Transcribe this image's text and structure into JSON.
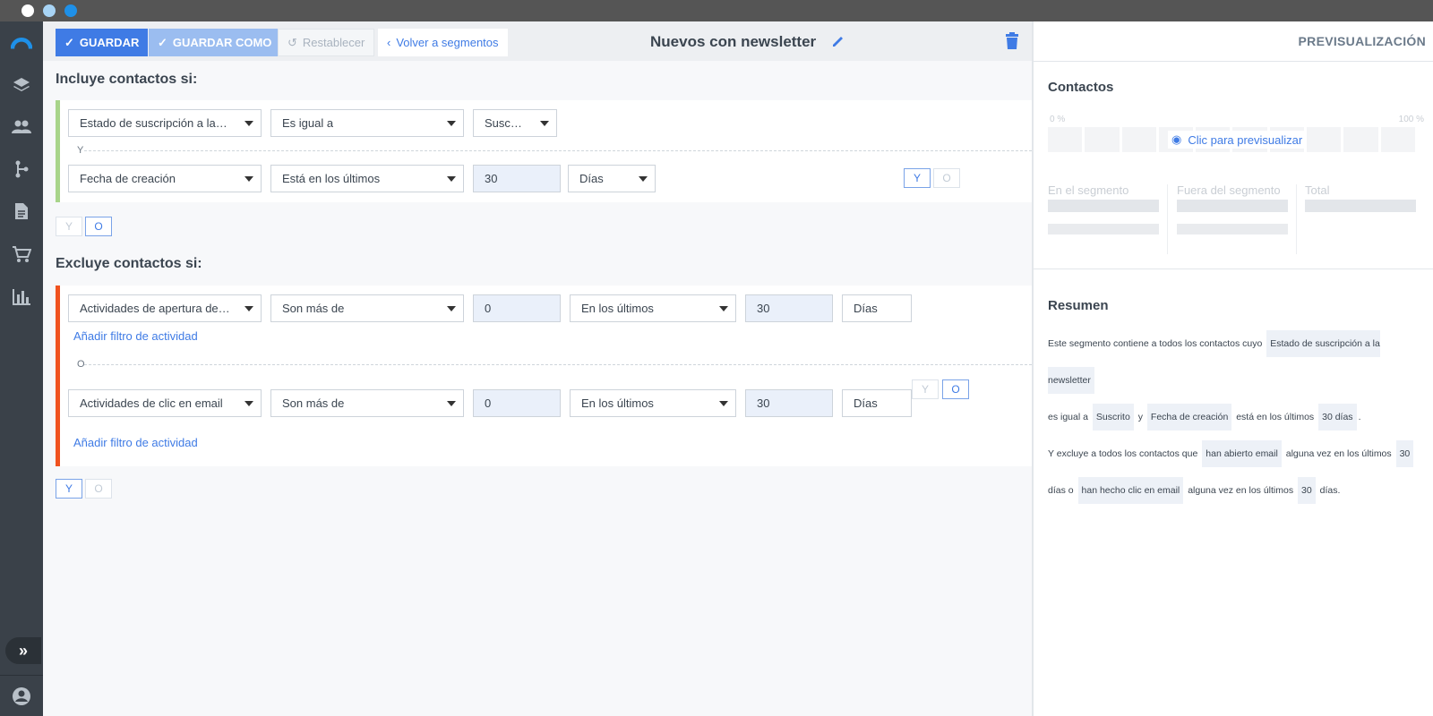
{
  "colors": {
    "accent": "#3f7be5",
    "include_bar": "#a8d48a",
    "exclude_bar": "#f0521f",
    "sidebar": "#3a4149"
  },
  "window": {
    "dots": [
      "#ffffff",
      "#a8d4f5",
      "#1e90e8"
    ]
  },
  "sidebar": {
    "items": [
      "logo-icon",
      "layers-icon",
      "contacts-icon",
      "automation-icon",
      "document-icon",
      "cart-icon",
      "chart-icon"
    ],
    "expand_icon": "double-chevron-icon",
    "user_icon": "user-icon"
  },
  "toolbar": {
    "save": "GUARDAR",
    "save_as": "GUARDAR COMO",
    "reset": "Restablecer",
    "back": "Volver a segmentos",
    "title": "Nuevos con newsletter",
    "edit_icon": "pencil-icon",
    "delete_icon": "trash-icon"
  },
  "include": {
    "heading": "Incluye contactos si:",
    "row1": {
      "field": "Estado de suscripción a la ne…",
      "op": "Es igual a",
      "value": "Suscrito"
    },
    "sep": "Y",
    "row2": {
      "field": "Fecha de creación",
      "op": "Está en los últimos",
      "value": "30",
      "unit": "Días"
    },
    "inner_toggle": {
      "y": "Y",
      "o": "O"
    },
    "outer_toggle": {
      "y": "Y",
      "o": "O"
    }
  },
  "exclude": {
    "heading": "Excluye contactos si:",
    "row1": {
      "field": "Actividades de apertura de e…",
      "op": "Son más de",
      "count": "0",
      "period": "En los últimos",
      "value": "30",
      "unit": "Días"
    },
    "add_filter": "Añadir filtro de actividad",
    "sep": "O",
    "row2": {
      "field": "Actividades de clic en email",
      "op": "Son más de",
      "count": "0",
      "period": "En los últimos",
      "value": "30",
      "unit": "Días"
    },
    "add_filter2": "Añadir filtro de actividad",
    "inner_toggle": {
      "y": "Y",
      "o": "O"
    },
    "outer_toggle": {
      "y": "Y",
      "o": "O"
    }
  },
  "preview": {
    "title": "PREVISUALIZACIÓN",
    "contacts_heading": "Contactos",
    "pct_min": "0 %",
    "pct_max": "100 %",
    "click_preview": "Clic para previsualizar",
    "stats": [
      "En el segmento",
      "Fuera del segmento",
      "Total"
    ]
  },
  "summary": {
    "heading": "Resumen",
    "t1": "Este segmento contiene a todos los contactos cuyo",
    "c1": "Estado de suscripción a la newsletter",
    "t2": "es igual a",
    "c2": "Suscrito",
    "t3": "y",
    "c3": "Fecha de creación",
    "t4": "está en los últimos",
    "c4": "30 días",
    "t5": ".",
    "t6": "Y excluye a todos los contactos que",
    "c5": "han abierto email",
    "t7": "alguna vez en los últimos",
    "c6": "30",
    "t8": "días o",
    "c7": "han hecho clic en email",
    "t9": "alguna vez en los últimos",
    "c8": "30",
    "t10": "días."
  }
}
